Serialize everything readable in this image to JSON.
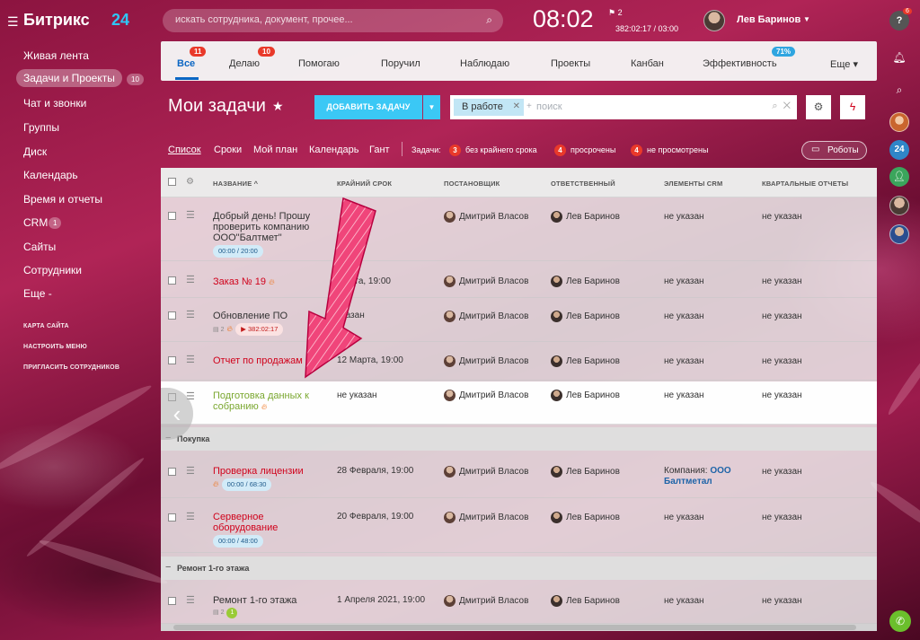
{
  "app": {
    "logo": "Битрикс",
    "logo_suffix": "24",
    "search_placeholder": "искать сотрудника, документ, прочее...",
    "clock": "08:02",
    "timer_flags": "2",
    "timer_value": "382:02:17 / 03:00",
    "user_name": "Лев Баринов"
  },
  "left_menu": {
    "items": [
      {
        "label": "Живая лента"
      },
      {
        "label": "Задачи и Проекты",
        "counter": "10"
      },
      {
        "label": "Чат и звонки"
      },
      {
        "label": "Группы"
      },
      {
        "label": "Диск"
      },
      {
        "label": "Календарь"
      },
      {
        "label": "Время и отчеты"
      },
      {
        "label": "CRM",
        "counter": "1"
      },
      {
        "label": "Сайты"
      },
      {
        "label": "Сотрудники"
      },
      {
        "label": "Еще -"
      }
    ],
    "links": [
      "КАРТА САЙТА",
      "НАСТРОИТЬ МЕНЮ",
      "ПРИГЛАСИТЬ СОТРУДНИКОВ"
    ]
  },
  "right_rail": {
    "help_badge": "6",
    "counter_label": "24"
  },
  "tabs": [
    {
      "label": "Все",
      "badge": "11"
    },
    {
      "label": "Делаю",
      "badge": "10"
    },
    {
      "label": "Помогаю"
    },
    {
      "label": "Поручил"
    },
    {
      "label": "Наблюдаю"
    },
    {
      "label": "Проекты"
    },
    {
      "label": "Канбан"
    },
    {
      "label": "Эффективность",
      "badge": "71%"
    },
    {
      "label": "Еще ▾"
    }
  ],
  "toolbar": {
    "title": "Мои задачи",
    "add_button": "ДОБАВИТЬ ЗАДАЧУ",
    "filter_chip": "В работе",
    "filter_placeholder": "поиск"
  },
  "views": {
    "items": [
      "Список",
      "Сроки",
      "Мой план",
      "Календарь",
      "Гант"
    ],
    "tasks_label": "Задачи:",
    "counters": [
      {
        "count": "3",
        "label": "без крайнего срока"
      },
      {
        "count": "4",
        "label": "просрочены"
      },
      {
        "count": "4",
        "label": "не просмотрены"
      }
    ],
    "robots": "Роботы"
  },
  "table": {
    "headers": [
      "НАЗВАНИЕ ^",
      "КРАЙНИЙ СРОК",
      "ПОСТАНОВЩИК",
      "ОТВЕТСТВЕННЫЙ",
      "ЭЛЕМЕНТЫ CRM",
      "КВАРТАЛЬНЫЕ ОТЧЕТЫ"
    ],
    "rows": [
      {
        "name": "Добрый день! Прошу проверить компанию ООО\"Балтмет\"",
        "timer": "00:00 / 20:00",
        "deadline": "",
        "creator": "Дмитрий Власов",
        "responsible": "Лев Баринов",
        "crm": "не указан",
        "report": "не указан"
      },
      {
        "name": "Заказ № 19",
        "deadline": "Марта, 19:00",
        "creator": "Дмитрий Власов",
        "responsible": "Лев Баринов",
        "crm": "не указан",
        "report": "не указан"
      },
      {
        "name": "Обновление ПО",
        "comments": "2",
        "timer": "382:02:17",
        "deadline": "указан",
        "creator": "Дмитрий Власов",
        "responsible": "Лев Баринов",
        "crm": "не указан",
        "report": "не указан"
      },
      {
        "name": "Отчет по продажам",
        "deadline": "12 Марта, 19:00",
        "creator": "Дмитрий Власов",
        "responsible": "Лев Баринов",
        "crm": "не указан",
        "report": "не указан"
      },
      {
        "name": "Подготовка данных к собранию",
        "deadline": "не указан",
        "creator": "Дмитрий Власов",
        "responsible": "Лев Баринов",
        "crm": "не указан",
        "report": "не указан"
      }
    ],
    "group1": "Покупка",
    "rows2": [
      {
        "name": "Проверка лицензии",
        "timer": "00:00 / 68:30",
        "deadline": "28 Февраля, 19:00",
        "creator": "Дмитрий Власов",
        "responsible": "Лев Баринов",
        "crm_prefix": "Компания:",
        "crm_link": "ООО Балтметал",
        "report": "не указан"
      },
      {
        "name": "Серверное оборудование",
        "timer": "00:00 / 48:00",
        "deadline": "20 Февраля, 19:00",
        "creator": "Дмитрий Власов",
        "responsible": "Лев Баринов",
        "crm": "не указан",
        "report": "не указан"
      }
    ],
    "group2": "Ремонт 1-го этажа",
    "rows3": [
      {
        "name": "Ремонт 1-го этажа",
        "comments": "2",
        "green": "1",
        "deadline": "1 Апреля 2021, 19:00",
        "creator": "Дмитрий Власов",
        "responsible": "Лев Баринов",
        "crm": "не указан",
        "report": "не указан"
      }
    ]
  }
}
